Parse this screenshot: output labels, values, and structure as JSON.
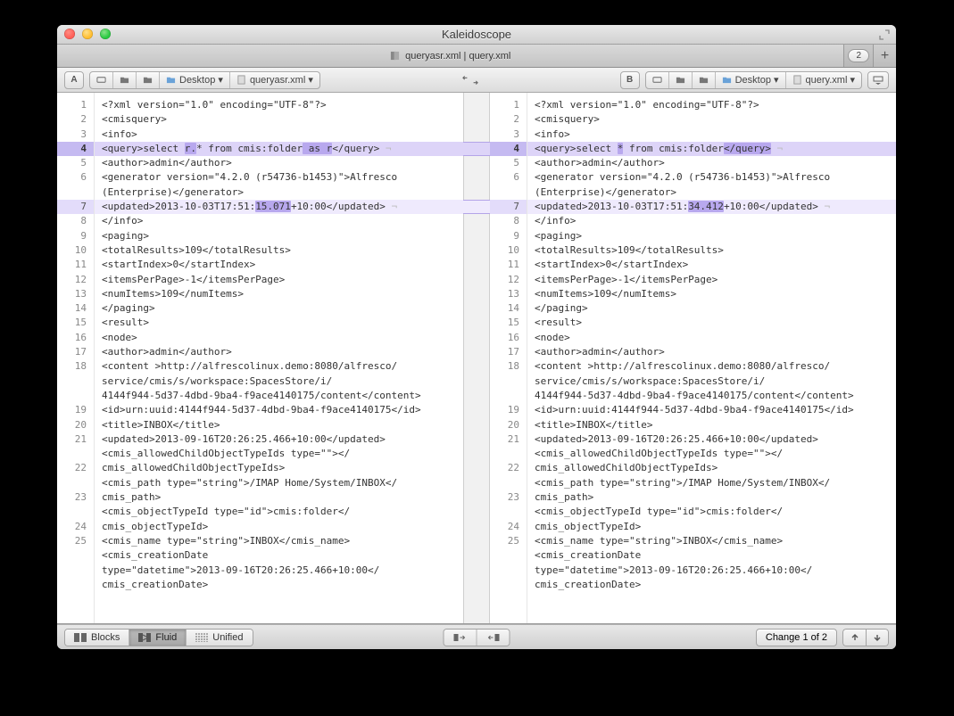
{
  "window": {
    "title": "Kaleidoscope"
  },
  "tabstrip": {
    "label": "queryasr.xml | query.xml",
    "badge": "2"
  },
  "toolbar": {
    "left_letter": "A",
    "right_letter": "B",
    "left_path": [
      "Desktop ▾",
      "queryasr.xml ▾"
    ],
    "right_path": [
      "Desktop ▾",
      "query.xml ▾"
    ]
  },
  "diff": {
    "left_lines": [
      "1",
      "2",
      "3",
      "4",
      "5",
      "6",
      "",
      "7",
      "8",
      "9",
      "10",
      "11",
      "12",
      "13",
      "14",
      "15",
      "16",
      "17",
      "18",
      "",
      "",
      "19",
      "20",
      "21",
      "",
      "22",
      "",
      "23",
      "",
      "24",
      "25",
      "",
      ""
    ],
    "right_lines": [
      "1",
      "2",
      "3",
      "4",
      "5",
      "6",
      "",
      "7",
      "8",
      "9",
      "10",
      "11",
      "12",
      "13",
      "14",
      "15",
      "16",
      "17",
      "18",
      "",
      "",
      "19",
      "20",
      "21",
      "",
      "22",
      "",
      "23",
      "",
      "24",
      "25",
      "",
      ""
    ],
    "left": [
      {
        "t": "<?xml version=\"1.0\" encoding=\"UTF-8\"?>"
      },
      {
        "t": "<cmisquery>"
      },
      {
        "t": "<info>"
      },
      {
        "t": "<query>select |r.|* from cmis:folder| as r|</query>",
        "hl": 1,
        "eol": 1
      },
      {
        "t": "<author>admin</author>"
      },
      {
        "t": "<generator version=\"4.2.0 (r54736-b1453)\">Alfresco\n(Enterprise)</generator>",
        "wrap": 1
      },
      {
        "t": "<updated>2013-10-03T17:51:|15.071|+10:00</updated>",
        "hl": 2,
        "eol": 1
      },
      {
        "t": "</info>"
      },
      {
        "t": "<paging>"
      },
      {
        "t": "<totalResults>109</totalResults>"
      },
      {
        "t": "<startIndex>0</startIndex>"
      },
      {
        "t": "<itemsPerPage>-1</itemsPerPage>"
      },
      {
        "t": "<numItems>109</numItems>"
      },
      {
        "t": "</paging>"
      },
      {
        "t": "<result>"
      },
      {
        "t": "<node>"
      },
      {
        "t": "<author>admin</author>"
      },
      {
        "t": "<content >http://alfrescolinux.demo:8080/alfresco/\nservice/cmis/s/workspace:SpacesStore/i/\n4144f944-5d37-4dbd-9ba4-f9ace4140175/content</content>\n<id>urn:uuid:4144f944-5d37-4dbd-9ba4-f9ace4140175</id>",
        "wrap": 1
      },
      {
        "t": "<title>INBOX</title>"
      },
      {
        "t": "<updated>2013-09-16T20:26:25.466+10:00</updated>"
      },
      {
        "t": "<cmis_allowedChildObjectTypeIds type=\"\"></\ncmis_allowedChildObjectTypeIds>",
        "wrap": 1
      },
      {
        "t": "<cmis_path type=\"string\">/IMAP Home/System/INBOX</\ncmis_path>",
        "wrap": 1
      },
      {
        "t": "<cmis_objectTypeId type=\"id\">cmis:folder</\ncmis_objectTypeId>",
        "wrap": 1
      },
      {
        "t": "<cmis_name type=\"string\">INBOX</cmis_name>"
      },
      {
        "t": "<cmis_creationDate\ntype=\"datetime\">2013-09-16T20:26:25.466+10:00</\ncmis_creationDate>",
        "wrap": 1
      }
    ],
    "right": [
      {
        "t": "<?xml version=\"1.0\" encoding=\"UTF-8\"?>"
      },
      {
        "t": "<cmisquery>"
      },
      {
        "t": "<info>"
      },
      {
        "t": "<query>select |*| from cmis:folder|</query>",
        "hl": 1,
        "eol": 1
      },
      {
        "t": "<author>admin</author>"
      },
      {
        "t": "<generator version=\"4.2.0 (r54736-b1453)\">Alfresco\n(Enterprise)</generator>",
        "wrap": 1
      },
      {
        "t": "<updated>2013-10-03T17:51:|34.412|+10:00</updated>",
        "hl": 2,
        "eol": 1
      },
      {
        "t": "</info>"
      },
      {
        "t": "<paging>"
      },
      {
        "t": "<totalResults>109</totalResults>"
      },
      {
        "t": "<startIndex>0</startIndex>"
      },
      {
        "t": "<itemsPerPage>-1</itemsPerPage>"
      },
      {
        "t": "<numItems>109</numItems>"
      },
      {
        "t": "</paging>"
      },
      {
        "t": "<result>"
      },
      {
        "t": "<node>"
      },
      {
        "t": "<author>admin</author>"
      },
      {
        "t": "<content >http://alfrescolinux.demo:8080/alfresco/\nservice/cmis/s/workspace:SpacesStore/i/\n4144f944-5d37-4dbd-9ba4-f9ace4140175/content</content>\n<id>urn:uuid:4144f944-5d37-4dbd-9ba4-f9ace4140175</id>",
        "wrap": 1
      },
      {
        "t": "<title>INBOX</title>"
      },
      {
        "t": "<updated>2013-09-16T20:26:25.466+10:00</updated>"
      },
      {
        "t": "<cmis_allowedChildObjectTypeIds type=\"\"></\ncmis_allowedChildObjectTypeIds>",
        "wrap": 1
      },
      {
        "t": "<cmis_path type=\"string\">/IMAP Home/System/INBOX</\ncmis_path>",
        "wrap": 1
      },
      {
        "t": "<cmis_objectTypeId type=\"id\">cmis:folder</\ncmis_objectTypeId>",
        "wrap": 1
      },
      {
        "t": "<cmis_name type=\"string\">INBOX</cmis_name>"
      },
      {
        "t": "<cmis_creationDate\ntype=\"datetime\">2013-09-16T20:26:25.466+10:00</\ncmis_creationDate>",
        "wrap": 1
      }
    ]
  },
  "footer": {
    "modes": [
      "Blocks",
      "Fluid",
      "Unified"
    ],
    "active": 1,
    "change_label": "Change 1 of 2"
  }
}
